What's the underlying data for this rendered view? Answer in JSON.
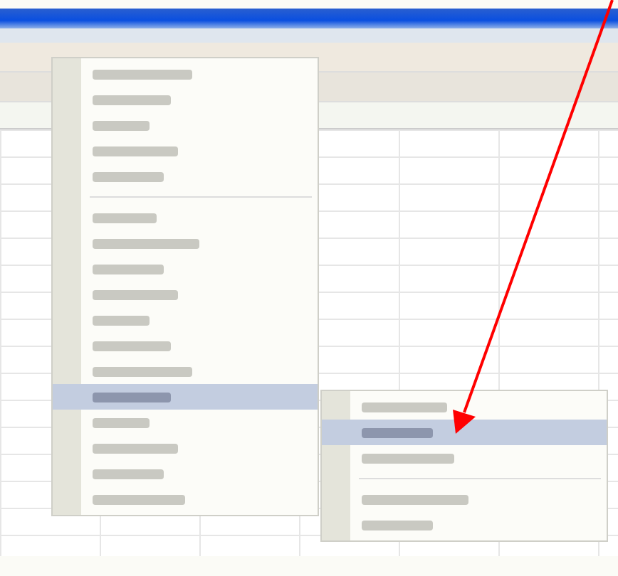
{
  "menu": {
    "items": [
      {
        "kind": "item",
        "selected": false
      },
      {
        "kind": "item",
        "selected": false
      },
      {
        "kind": "item",
        "selected": false
      },
      {
        "kind": "item",
        "selected": false
      },
      {
        "kind": "item",
        "selected": false
      },
      {
        "kind": "separator"
      },
      {
        "kind": "item",
        "selected": false
      },
      {
        "kind": "item",
        "selected": false
      },
      {
        "kind": "item",
        "selected": false
      },
      {
        "kind": "item",
        "selected": false
      },
      {
        "kind": "item",
        "selected": false
      },
      {
        "kind": "item",
        "selected": false
      },
      {
        "kind": "item",
        "selected": false
      },
      {
        "kind": "item",
        "selected": true
      },
      {
        "kind": "item",
        "selected": false
      },
      {
        "kind": "item",
        "selected": false
      },
      {
        "kind": "item",
        "selected": false
      },
      {
        "kind": "item",
        "selected": false
      }
    ]
  },
  "submenu": {
    "items": [
      {
        "kind": "item",
        "selected": false
      },
      {
        "kind": "item",
        "selected": true
      },
      {
        "kind": "item",
        "selected": false
      },
      {
        "kind": "separator"
      },
      {
        "kind": "item",
        "selected": false
      },
      {
        "kind": "item",
        "selected": false
      }
    ]
  },
  "annotation": {
    "kind": "arrow"
  }
}
